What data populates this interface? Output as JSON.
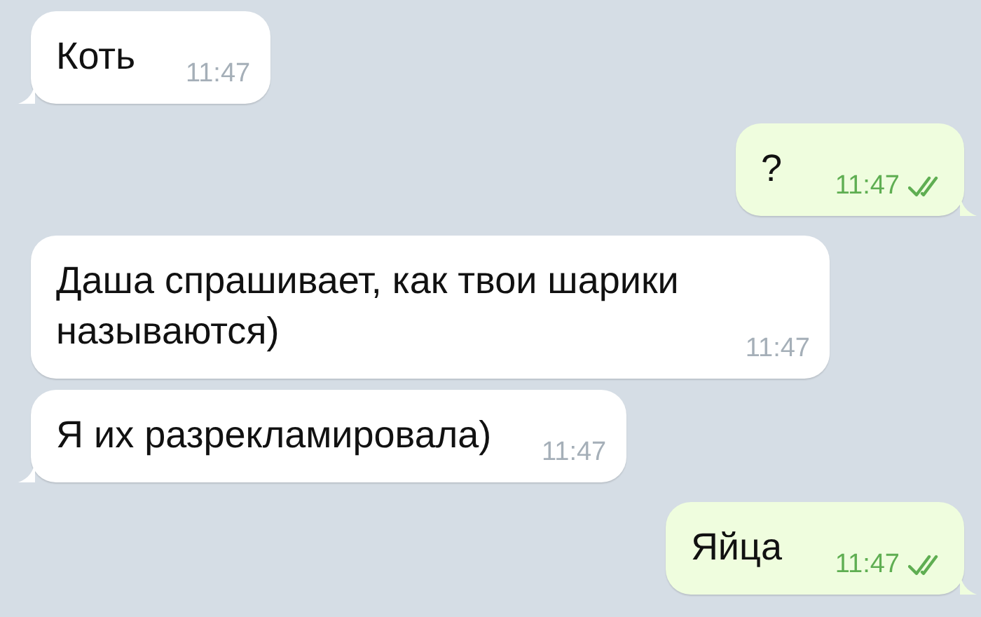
{
  "messages": [
    {
      "text": "Коть",
      "time": "11:47",
      "outgoing": false,
      "read": false,
      "tail": true
    },
    {
      "text": "?",
      "time": "11:47",
      "outgoing": true,
      "read": true,
      "tail": true
    },
    {
      "text": "Даша спрашивает, как твои шарики называются)",
      "time": "11:47",
      "outgoing": false,
      "read": false,
      "tail": false
    },
    {
      "text": "Я их разрекламировала)",
      "time": "11:47",
      "outgoing": false,
      "read": false,
      "tail": true
    },
    {
      "text": "Яйца",
      "time": "11:47",
      "outgoing": true,
      "read": true,
      "tail": true
    }
  ]
}
